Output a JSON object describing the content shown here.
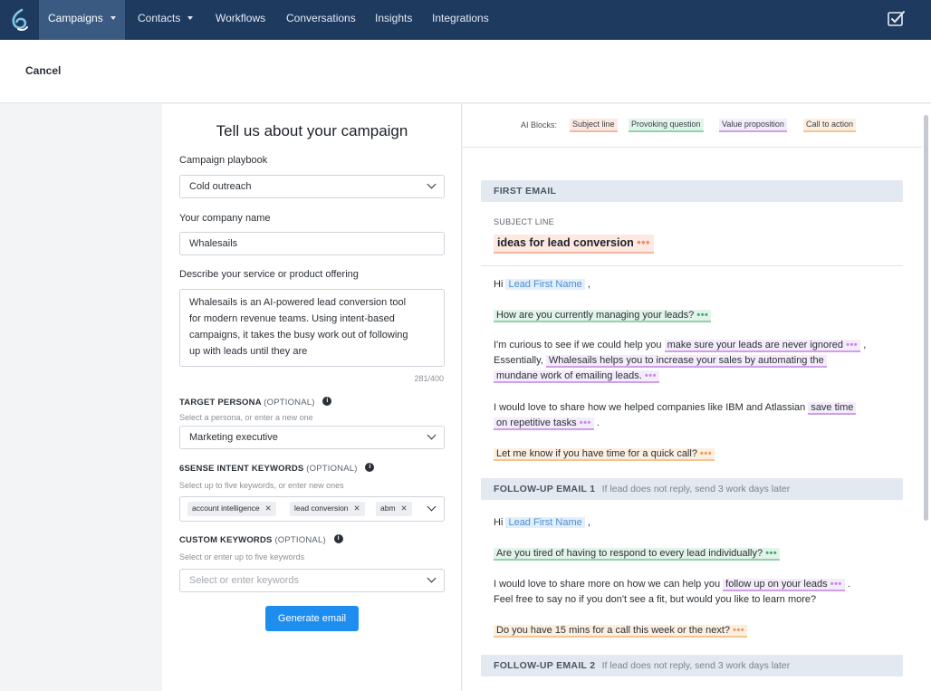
{
  "nav": {
    "items": [
      {
        "label": "Campaigns",
        "caret": true
      },
      {
        "label": "Contacts",
        "caret": true
      },
      {
        "label": "Workflows",
        "caret": false
      },
      {
        "label": "Conversations",
        "caret": false
      },
      {
        "label": "Insights",
        "caret": false
      },
      {
        "label": "Integrations",
        "caret": false
      }
    ],
    "brand_color": "#1f3a5f",
    "active_color": "#3b5a82"
  },
  "header": {
    "cancel_label": "Cancel"
  },
  "form": {
    "title": "Tell us about your campaign",
    "playbook": {
      "label": "Campaign playbook",
      "value": "Cold outreach"
    },
    "company": {
      "label": "Your company name",
      "value": "Whalesails"
    },
    "service": {
      "label": "Describe your service or product offering",
      "lines": [
        "Whalesails is an AI-powered lead conversion tool",
        "for modern revenue teams. Using intent-based",
        "campaigns, it takes the busy work out of following",
        "up with leads until they are"
      ],
      "counter": "281/400"
    },
    "persona": {
      "label": "TARGET PERSONA",
      "optional": "(OPTIONAL)",
      "hint": "Select a persona, or enter a new one",
      "value": "Marketing executive"
    },
    "intent": {
      "label": "6SENSE INTENT KEYWORDS",
      "optional": "(OPTIONAL)",
      "hint": "Select up to five keywords, or enter new ones",
      "tags": [
        "account intelligence",
        "lead conversion",
        "abm"
      ]
    },
    "custom": {
      "label": "CUSTOM KEYWORDS",
      "optional": "(OPTIONAL)",
      "hint": "Select or enter up to five keywords",
      "placeholder": "Select or enter keywords"
    },
    "generate_label": "Generate email",
    "button_color": "#1d8ef0"
  },
  "preview": {
    "blocks_label": "AI Blocks:",
    "blocks": [
      "Subject line",
      "Provoking question",
      "Value proposition",
      "Call to action"
    ],
    "first": {
      "title": "FIRST EMAIL",
      "subject_label": "SUBJECT LINE",
      "subject": "ideas for lead conversion",
      "greeting": "Hi",
      "var": "Lead First Name",
      "comma": ",",
      "question": "How are you currently managing your leads?",
      "p1_a": "I'm curious to see if we could help you",
      "p1_hl": "make sure your leads are never ignored",
      "p1_end": ",",
      "p1_b": "Essentially,",
      "p1_hl2a": "Whalesails helps you to increase your sales by automating the",
      "p1_hl2b": "mundane work of emailing leads.",
      "p2_a": "I would love to share how we helped companies like IBM and Atlassian",
      "p2_hl_a": "save time",
      "p2_hl_b": "on repetitive tasks",
      "p2_end": ".",
      "cta": "Let me know if you have time for a quick call?"
    },
    "followup1": {
      "title": "FOLLOW-UP EMAIL 1",
      "note": "If lead does not reply, send 3 work days later",
      "greeting": "Hi",
      "var": "Lead First Name",
      "comma": ",",
      "question": "Are you tired of having to respond to every lead individually?",
      "p1_a": "I would love to share more on how we can help you",
      "p1_hl": "follow up on your leads",
      "p1_end": ".",
      "p1_b": "Feel free to say no if you don't see a fit, but would you like to learn more?",
      "cta": "Do you have 15 mins for a call this week or the next?"
    },
    "followup2": {
      "title": "FOLLOW-UP EMAIL 2",
      "note": "If lead does not reply, send 3 work days later"
    },
    "dots": "•••"
  }
}
